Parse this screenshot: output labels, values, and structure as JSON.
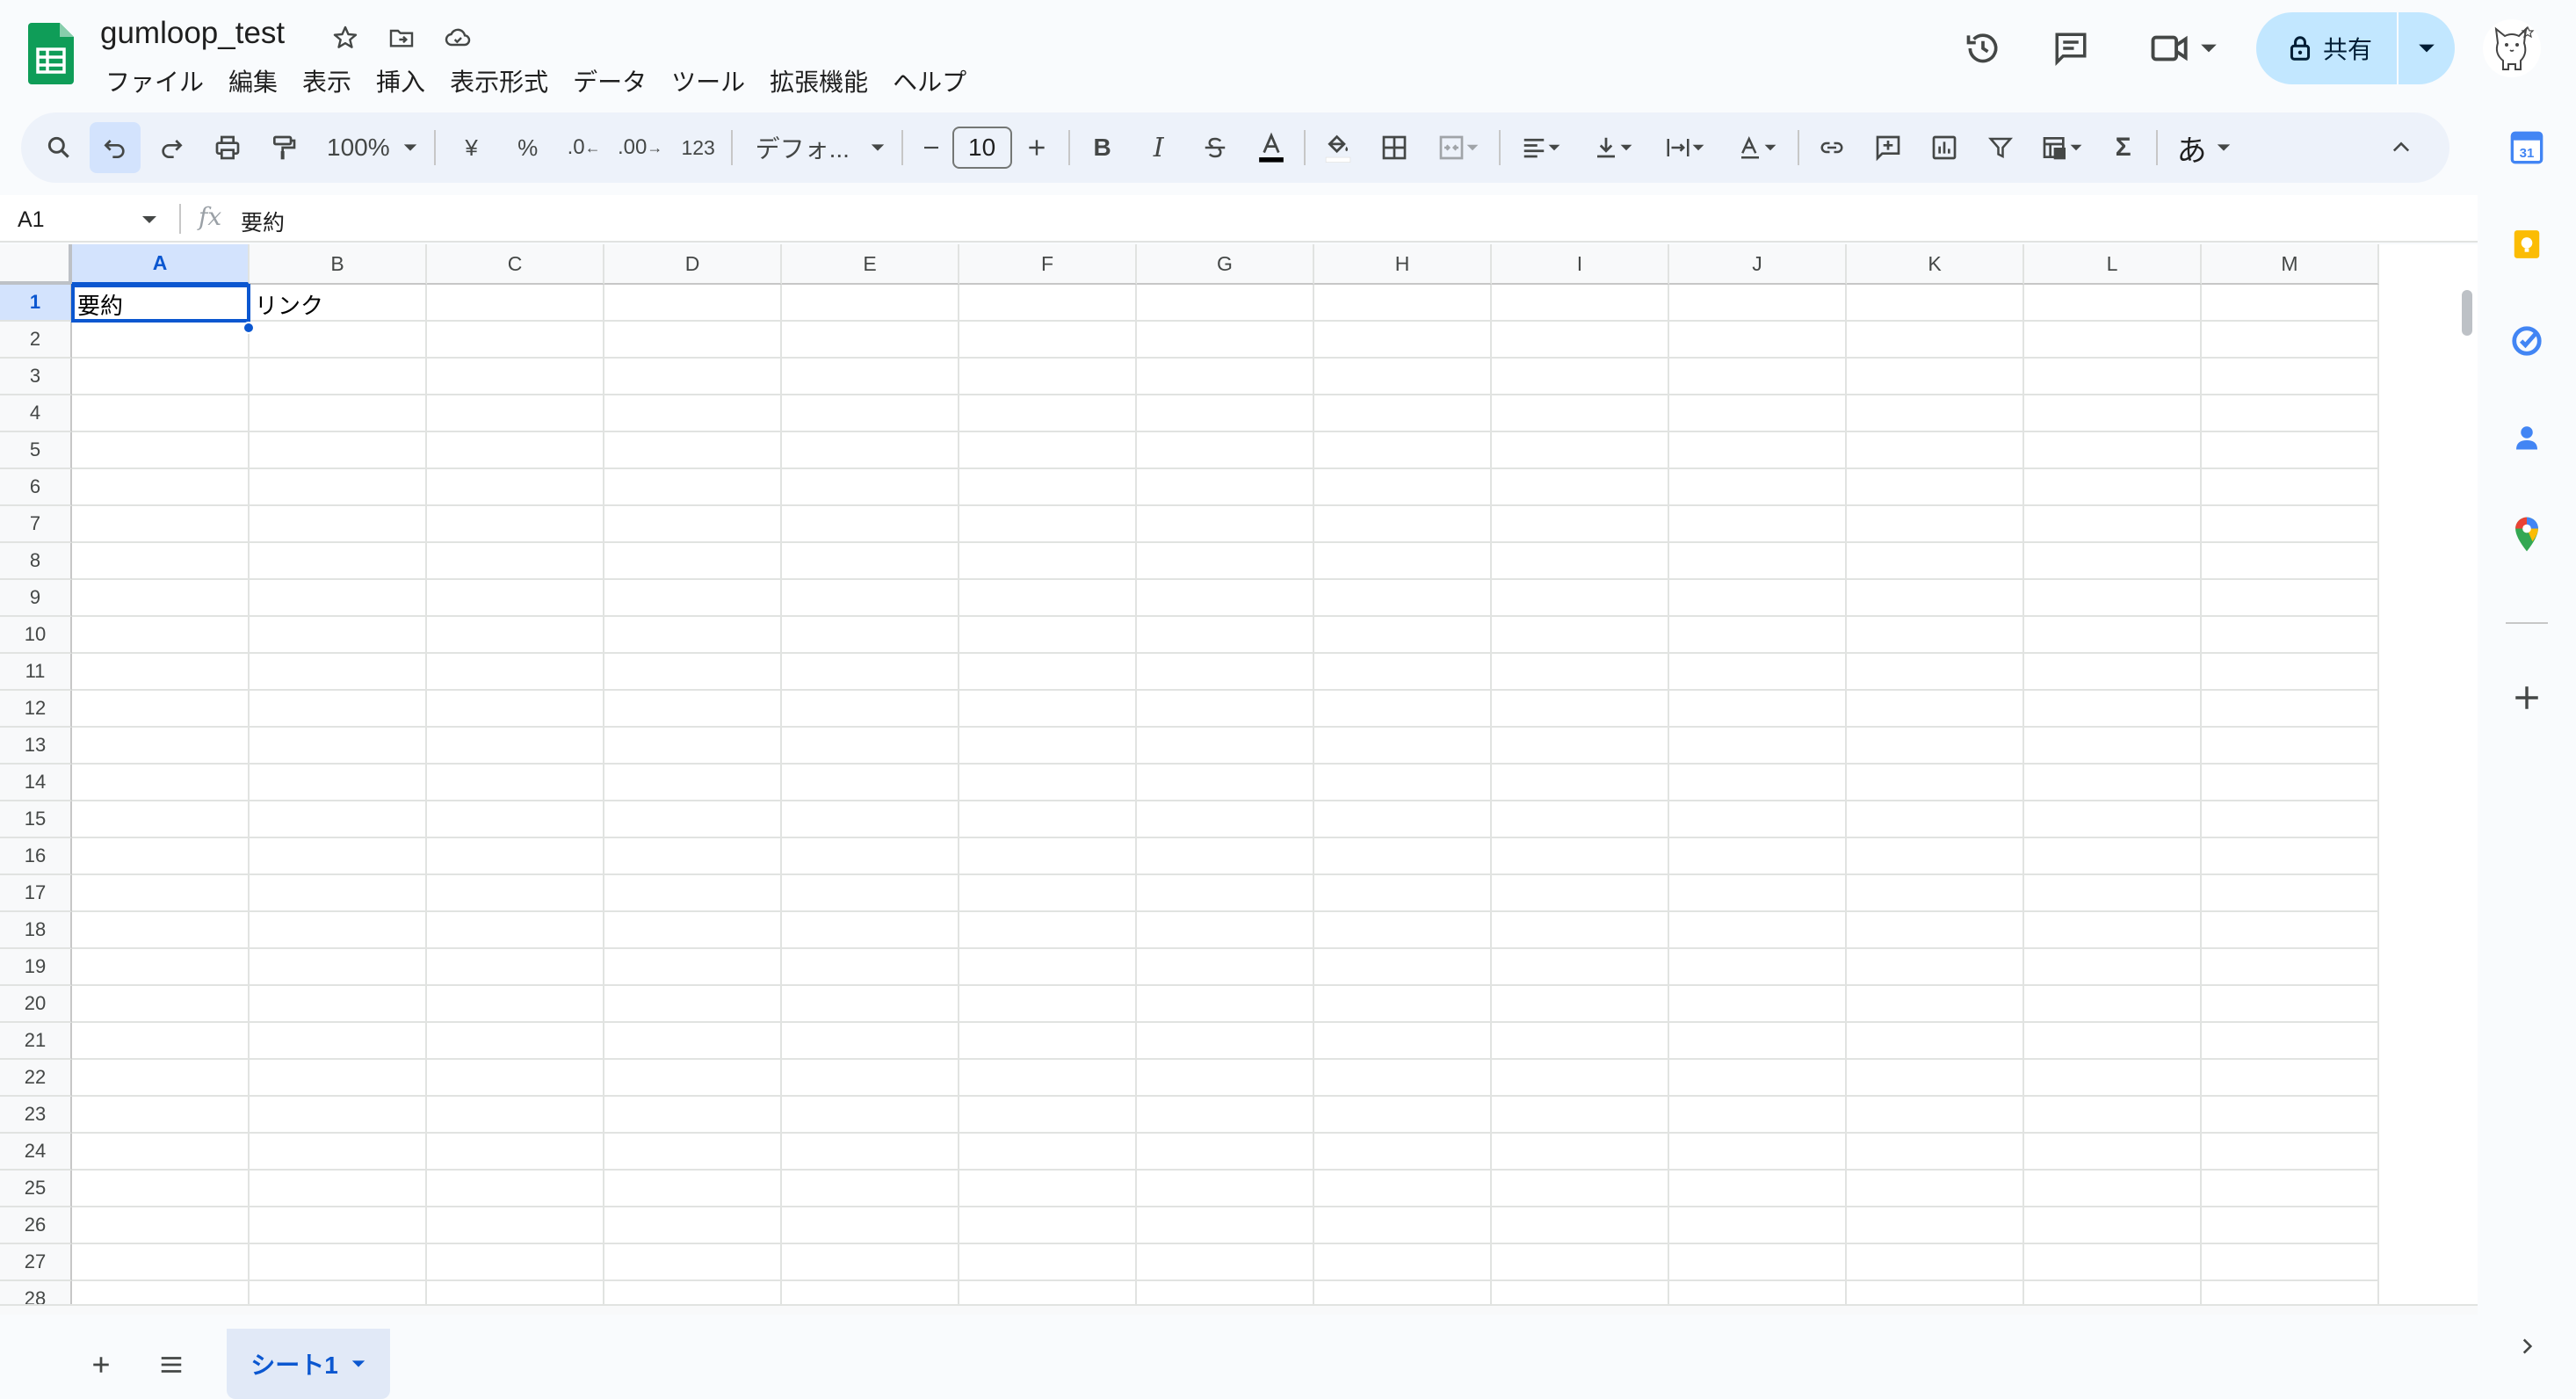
{
  "header": {
    "doc_title": "gumloop_test",
    "menu": [
      "ファイル",
      "編集",
      "表示",
      "挿入",
      "表示形式",
      "データ",
      "ツール",
      "拡張機能",
      "ヘルプ"
    ],
    "share_label": "共有"
  },
  "toolbar": {
    "zoom": "100%",
    "currency": "¥",
    "percent": "%",
    "decrease_decimal": ".0",
    "increase_decimal": ".00",
    "number_format": "123",
    "font": "デフォ...",
    "font_size": "10",
    "input_tool": "あ"
  },
  "formula_bar": {
    "cell_ref": "A1",
    "fx": "fx",
    "content": "要約"
  },
  "grid": {
    "columns": [
      "A",
      "B",
      "C",
      "D",
      "E",
      "F",
      "G",
      "H",
      "I",
      "J",
      "K",
      "L",
      "M"
    ],
    "rows": [
      "1",
      "2",
      "3",
      "4",
      "5",
      "6",
      "7",
      "8",
      "9",
      "10",
      "11",
      "12",
      "13",
      "14",
      "15",
      "16",
      "17",
      "18",
      "19",
      "20",
      "21",
      "22",
      "23",
      "24",
      "25",
      "26",
      "27",
      "28"
    ],
    "cell_A1": "要約",
    "cell_B1": "リンク",
    "selected_cell": "A1"
  },
  "sheets": {
    "tabs": [
      "シート1"
    ]
  },
  "colors": {
    "accent": "#0b57d0",
    "share_bg": "#c2e7ff",
    "selection_bg": "#d3e3fd",
    "sheets_green": "#0f9d58"
  },
  "side_panel": {
    "icons": [
      "calendar-icon",
      "keep-icon",
      "tasks-icon",
      "contacts-icon",
      "maps-icon",
      "add-icon"
    ]
  }
}
